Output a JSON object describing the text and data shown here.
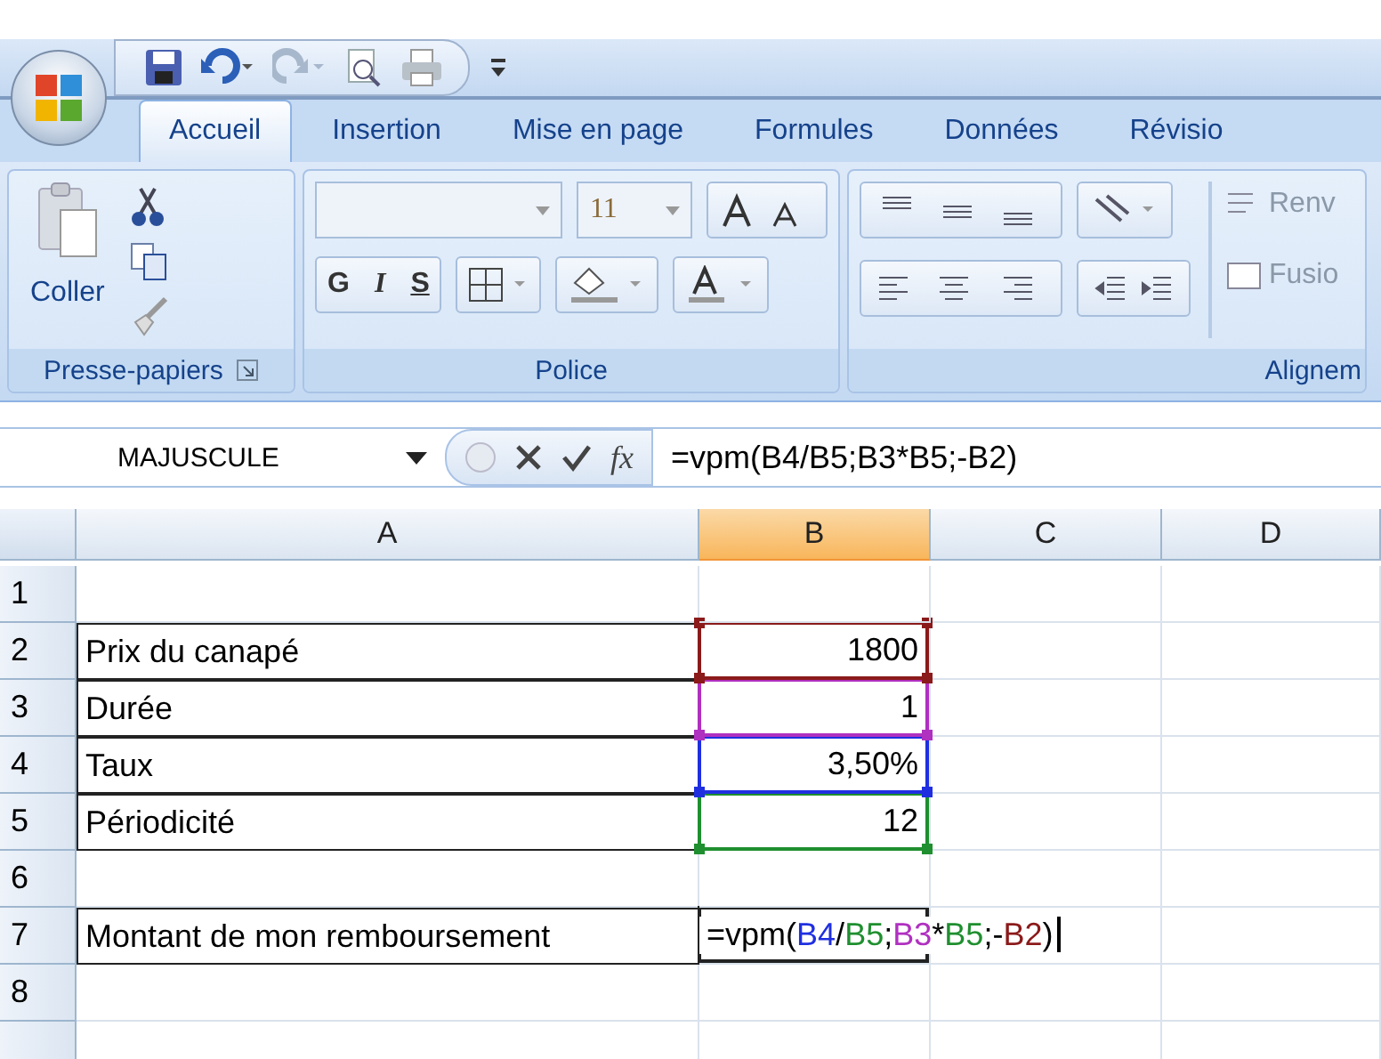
{
  "tabs": [
    {
      "label": "Accueil",
      "selected": true
    },
    {
      "label": "Insertion",
      "selected": false
    },
    {
      "label": "Mise en page",
      "selected": false
    },
    {
      "label": "Formules",
      "selected": false
    },
    {
      "label": "Données",
      "selected": false
    },
    {
      "label": "Révisio",
      "selected": false
    }
  ],
  "ribbon": {
    "clipboard": {
      "paste": "Coller",
      "title": "Presse-papiers"
    },
    "font": {
      "size": "11",
      "title": "Police",
      "bold": "G",
      "italic": "I",
      "underline": "S"
    },
    "alignment": {
      "wrap": "Renv",
      "merge": "Fusio",
      "title": "Alignem"
    }
  },
  "formula_bar": {
    "name_box": "MAJUSCULE",
    "fx": "fx",
    "formula": "=vpm(B4/B5;B3*B5;-B2)"
  },
  "columns": [
    {
      "label": "A",
      "selected": false
    },
    {
      "label": "B",
      "selected": true
    },
    {
      "label": "C",
      "selected": false
    },
    {
      "label": "D",
      "selected": false
    }
  ],
  "rows": [
    {
      "number": "1"
    },
    {
      "number": "2",
      "label": "Prix du canapé",
      "value": "1800",
      "color": "#8b1a1a"
    },
    {
      "number": "3",
      "label": "Durée",
      "value": "1",
      "color": "#b030c0"
    },
    {
      "number": "4",
      "label": "Taux",
      "value": "3,50%",
      "color": "#1f2fe0"
    },
    {
      "number": "5",
      "label": "Périodicité",
      "value": "12",
      "color": "#1f8f2f"
    },
    {
      "number": "6"
    },
    {
      "number": "7",
      "label": "Montant de mon remboursement",
      "formula_parts": [
        {
          "text": "=vpm(",
          "color": "#000000"
        },
        {
          "text": "B4",
          "color": "#1f2fe0"
        },
        {
          "text": "/",
          "color": "#000000"
        },
        {
          "text": "B5",
          "color": "#1f8f2f"
        },
        {
          "text": ";",
          "color": "#000000"
        },
        {
          "text": "B3",
          "color": "#b030c0"
        },
        {
          "text": "*",
          "color": "#000000"
        },
        {
          "text": "B5",
          "color": "#1f8f2f"
        },
        {
          "text": ";-",
          "color": "#000000"
        },
        {
          "text": "B2",
          "color": "#8b1a1a"
        },
        {
          "text": ")",
          "color": "#000000"
        }
      ]
    },
    {
      "number": "8"
    }
  ]
}
